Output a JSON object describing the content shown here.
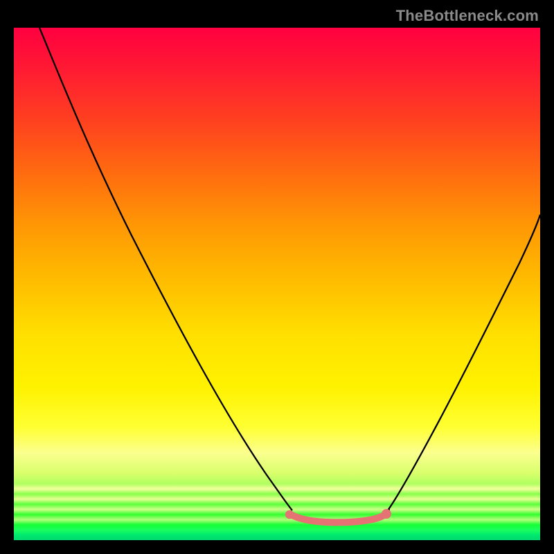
{
  "watermark": "TheBottleneck.com",
  "chart_data": {
    "type": "line",
    "title": "",
    "xlabel": "",
    "ylabel": "",
    "xlim": [
      0,
      100
    ],
    "ylim": [
      0,
      100
    ],
    "grid": false,
    "legend": null,
    "series": [
      {
        "name": "left-descending-curve",
        "color": "#000000",
        "style": "solid",
        "x": [
          0,
          5,
          12,
          20,
          28,
          36,
          44,
          50,
          53
        ],
        "values": [
          100,
          90,
          78,
          64,
          50,
          36,
          22,
          12,
          8
        ]
      },
      {
        "name": "right-ascending-curve",
        "color": "#000000",
        "style": "solid",
        "x": [
          71,
          75,
          80,
          85,
          90,
          95,
          100
        ],
        "values": [
          8,
          14,
          24,
          37,
          50,
          62,
          70
        ]
      },
      {
        "name": "bottom-plateau",
        "color": "#e57373",
        "style": "thick-flat",
        "x": [
          52,
          55,
          58,
          61,
          64,
          67,
          70
        ],
        "values": [
          4,
          3.6,
          3.4,
          3.4,
          3.4,
          3.6,
          4.4
        ]
      }
    ],
    "markers": [
      {
        "name": "plateau-left-dot",
        "x": 52.0,
        "y": 4.4,
        "r": 2.6,
        "color": "#e57373"
      },
      {
        "name": "plateau-right-dot",
        "x": 70.5,
        "y": 5.0,
        "r": 3.0,
        "color": "#e57373"
      },
      {
        "name": "tick-mark",
        "x": 71.0,
        "y": 6.0,
        "r": 0.0,
        "color": "#000000"
      }
    ]
  }
}
